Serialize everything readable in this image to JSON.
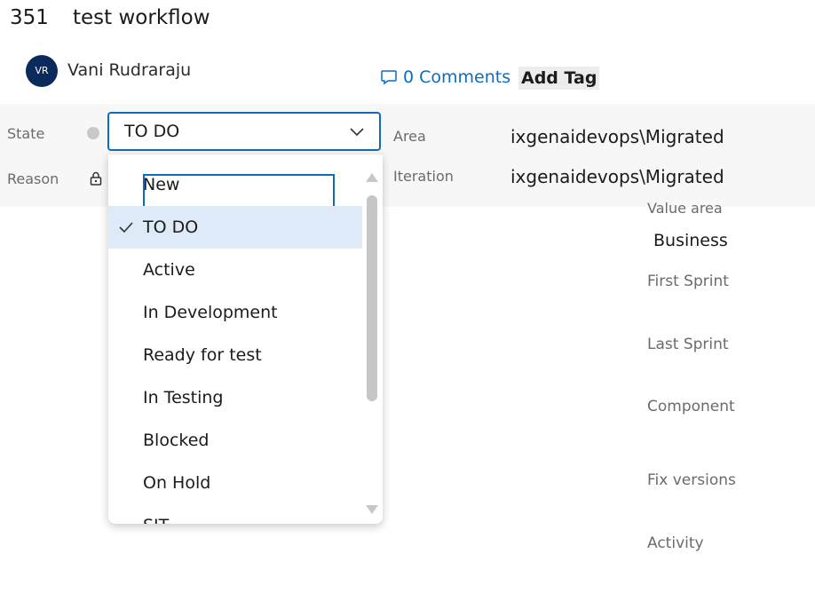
{
  "workitem": {
    "id": "351",
    "title": "test workflow"
  },
  "user": {
    "initials": "VR",
    "name": "Vani Rudraraju"
  },
  "header": {
    "comments": "0 Comments",
    "add_tag": "Add Tag"
  },
  "fields": {
    "state_label": "State",
    "state_value": "TO DO",
    "reason_label": "Reason",
    "area_label": "Area",
    "area_value": "ixgenaidevops\\Migrated",
    "iteration_label": "Iteration",
    "iteration_value": "ixgenaidevops\\Migrated"
  },
  "right_panel": {
    "value_area_label": "Value area",
    "value_area_value": "Business",
    "first_sprint": "First Sprint",
    "last_sprint": "Last Sprint",
    "component": "Component",
    "fix_versions": "Fix versions",
    "activity": "Activity"
  },
  "dropdown": {
    "options": [
      "New",
      "TO DO",
      "Active",
      "In Development",
      "Ready for test",
      "In Testing",
      "Blocked",
      "On Hold",
      "SIT"
    ],
    "selected": "TO DO",
    "focused": "New"
  },
  "colors": {
    "accent": "#0f6cbd",
    "selected_bg": "#deeaf7",
    "avatar_bg": "#0b2a5c"
  }
}
